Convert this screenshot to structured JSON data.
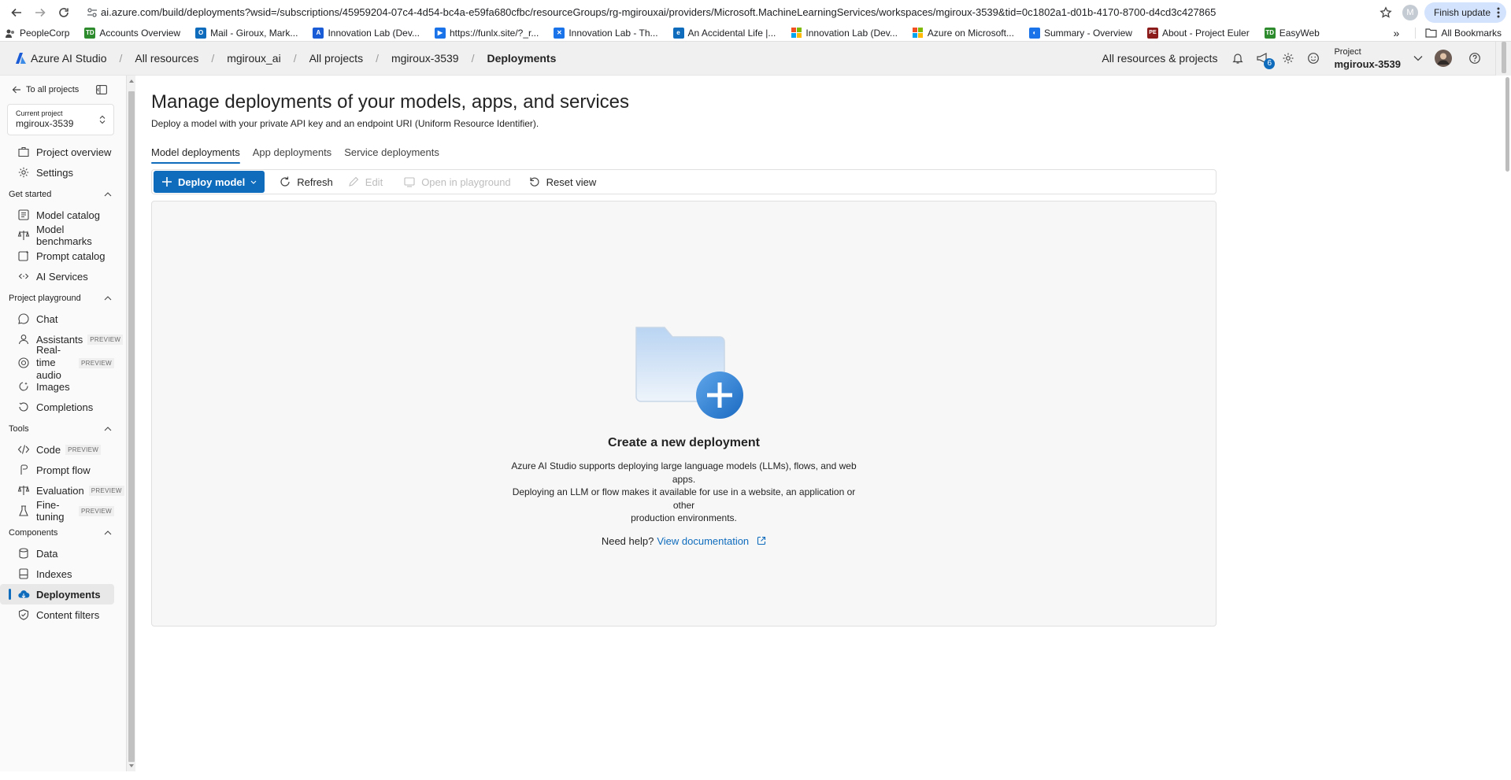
{
  "browser": {
    "url": "ai.azure.com/build/deployments?wsid=/subscriptions/45959204-07c4-4d54-bc4a-e59fa680cfbc/resourceGroups/rg-mgirouxai/providers/Microsoft.MachineLearningServices/workspaces/mgiroux-3539&tid=0c1802a1-d01b-4170-8700-d4cd3c427865",
    "profile_initial": "M",
    "finish_update_label": "Finish update"
  },
  "bookmarks": [
    {
      "label": "PeopleCorp",
      "icon_color": "#ffffff",
      "icon_text": ""
    },
    {
      "label": "Accounts Overview",
      "icon_color": "#2d8a2d",
      "icon_text": "TD"
    },
    {
      "label": "Mail - Giroux, Mark...",
      "icon_color": "#0f6cbd",
      "icon_text": "O"
    },
    {
      "label": "Innovation Lab (Dev...",
      "icon_color": "#1a5bd6",
      "icon_text": "A"
    },
    {
      "label": "https://funlx.site/?_r...",
      "icon_color": "#1a73e8",
      "icon_text": "▶"
    },
    {
      "label": "Innovation Lab - Th...",
      "icon_color": "#1a73e8",
      "icon_text": "✕"
    },
    {
      "label": "An Accidental Life |...",
      "icon_color": "#0f6cbd",
      "icon_text": "e"
    },
    {
      "label": "Innovation Lab (Dev...",
      "icon_color": "#f25022",
      "icon_text": ""
    },
    {
      "label": "Azure on Microsoft...",
      "icon_color": "#7fba00",
      "icon_text": ""
    },
    {
      "label": "Summary - Overview",
      "icon_color": "#1a73e8",
      "icon_text": "◐"
    },
    {
      "label": "About - Project Euler",
      "icon_color": "#8b1a1a",
      "icon_text": "PE"
    },
    {
      "label": "EasyWeb",
      "icon_color": "#2d8a2d",
      "icon_text": "TD"
    }
  ],
  "bookmarks_more": "»",
  "all_bookmarks_label": "All Bookmarks",
  "header": {
    "brand": "Azure AI Studio",
    "breadcrumbs": [
      "All resources",
      "mgiroux_ai",
      "All projects",
      "mgiroux-3539",
      "Deployments"
    ],
    "all_resources_label": "All resources & projects",
    "notification_count": "6",
    "project_label": "Project",
    "project_name": "mgiroux-3539"
  },
  "sidebar": {
    "back_label": "To all projects",
    "current_project_label": "Current project",
    "current_project_name": "mgiroux-3539",
    "top_items": [
      {
        "label": "Project overview",
        "icon": "project-overview-icon"
      },
      {
        "label": "Settings",
        "icon": "settings-icon"
      }
    ],
    "sections": [
      {
        "title": "Get started",
        "items": [
          {
            "label": "Model catalog",
            "icon": "model-catalog-icon"
          },
          {
            "label": "Model benchmarks",
            "icon": "model-benchmarks-icon"
          },
          {
            "label": "Prompt catalog",
            "icon": "prompt-catalog-icon"
          },
          {
            "label": "AI Services",
            "icon": "ai-services-icon"
          }
        ]
      },
      {
        "title": "Project playground",
        "items": [
          {
            "label": "Chat",
            "icon": "chat-icon"
          },
          {
            "label": "Assistants",
            "icon": "assistants-icon",
            "preview": "PREVIEW"
          },
          {
            "label": "Real-time audio",
            "icon": "realtime-audio-icon",
            "preview": "PREVIEW"
          },
          {
            "label": "Images",
            "icon": "images-icon"
          },
          {
            "label": "Completions",
            "icon": "completions-icon"
          }
        ]
      },
      {
        "title": "Tools",
        "items": [
          {
            "label": "Code",
            "icon": "code-icon",
            "preview": "PREVIEW"
          },
          {
            "label": "Prompt flow",
            "icon": "prompt-flow-icon"
          },
          {
            "label": "Evaluation",
            "icon": "evaluation-icon",
            "preview": "PREVIEW"
          },
          {
            "label": "Fine-tuning",
            "icon": "fine-tuning-icon",
            "preview": "PREVIEW"
          }
        ]
      },
      {
        "title": "Components",
        "items": [
          {
            "label": "Data",
            "icon": "data-icon"
          },
          {
            "label": "Indexes",
            "icon": "indexes-icon"
          },
          {
            "label": "Deployments",
            "icon": "deployments-icon",
            "active": true
          },
          {
            "label": "Content filters",
            "icon": "content-filters-icon"
          }
        ]
      }
    ]
  },
  "main": {
    "title": "Manage deployments of your models, apps, and services",
    "subtitle": "Deploy a model with your private API key and an endpoint URI (Uniform Resource Identifier).",
    "tabs": [
      {
        "label": "Model deployments",
        "active": true
      },
      {
        "label": "App deployments"
      },
      {
        "label": "Service deployments"
      }
    ],
    "toolbar": {
      "deploy_label": "Deploy model",
      "refresh_label": "Refresh",
      "edit_label": "Edit",
      "open_playground_label": "Open in playground",
      "reset_view_label": "Reset view"
    },
    "empty": {
      "title": "Create a new deployment",
      "desc_line1": "Azure AI Studio supports deploying large language models (LLMs), flows, and web apps.",
      "desc_line2": "Deploying an LLM or flow makes it available for use in a website, an application or other",
      "desc_line3": "production environments.",
      "help_prefix": "Need help?",
      "help_link": "View documentation"
    }
  },
  "colors": {
    "accent": "#0f6cbd",
    "header_bg": "#f0f0f0",
    "sidebar_bg": "#fafafa"
  }
}
